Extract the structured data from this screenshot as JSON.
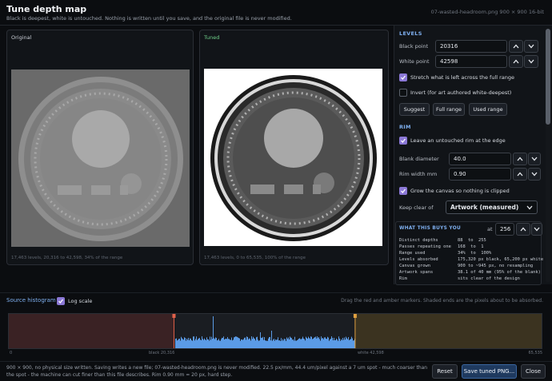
{
  "window": {
    "title": "Tune depth map",
    "subtitle": "Black is deepest, white is untouched. Nothing is written until you save, and the original file is never modified.",
    "file_info": "07-wasted-headroom.png   900 × 900   16-bit"
  },
  "preview": {
    "original": {
      "label": "Original",
      "footer": "17,463 levels, 20,316 to 42,598, 34% of the range"
    },
    "tuned": {
      "label": "Tuned",
      "footer": "17,463 levels, 0 to 65,535, 100% of the range"
    }
  },
  "levels": {
    "heading": "LEVELS",
    "black_point_label": "Black point",
    "black_point_value": "20316",
    "white_point_label": "White point",
    "white_point_value": "42598",
    "stretch_label": "Stretch what is left across the full range",
    "stretch_checked": true,
    "invert_label": "Invert (for art authored white-deepest)",
    "invert_checked": false,
    "buttons": [
      "Suggest",
      "Full range",
      "Used range"
    ]
  },
  "rim": {
    "heading": "RIM",
    "leave_rim_label": "Leave an untouched rim at the edge",
    "leave_rim_checked": true,
    "blank_diameter_label": "Blank diameter",
    "blank_diameter_value": "40.0",
    "rim_width_label": "Rim width mm",
    "rim_width_value": "0.90",
    "grow_label": "Grow the canvas so nothing is clipped",
    "grow_checked": true,
    "keep_clear_label": "Keep clear of",
    "keep_clear_value": "Artwork (measured)"
  },
  "buys": {
    "heading": "WHAT THIS BUYS YOU",
    "at_label": "at",
    "at_value": "256",
    "rows": [
      {
        "k": "Distinct depths",
        "v": "88  to  255"
      },
      {
        "k": "Passes repeating one",
        "v": "168  to  1"
      },
      {
        "k": "Range used",
        "v": "34%  to  100%"
      },
      {
        "k": "Levels absorbed",
        "v": "175,320 px black, 65,200 px white"
      },
      {
        "k": "Canvas grown",
        "v": "900 to ~945 px, no resampling"
      },
      {
        "k": "Artwork spans",
        "v": "38.1 of 40 mm (95% of the blank)"
      },
      {
        "k": "Rim",
        "v": "sits clear of the design"
      }
    ]
  },
  "histogram": {
    "title": "Source histogram",
    "log_label": "Log scale",
    "log_checked": true,
    "hint": "Drag the red and amber markers. Shaded ends are the pixels about to be absorbed.",
    "axis_min": "0",
    "axis_max": "65,535",
    "black_marker_label": "black 20,316",
    "white_marker_label": "white 42,598",
    "black_point": 20316,
    "white_point": 42598,
    "range_max": 65535
  },
  "footer": {
    "status": "900 × 900, no physical size written. Saving writes a new file; 07-wasted-headroom.png is never modified.   22.5 px/mm, 44.4 um/pixel against a 7 um spot - much coarser than the spot - the machine can cut finer than this file describes.  Rim 0.90 mm = 20 px, hard step.",
    "reset_label": "Reset",
    "save_label": "Save tuned PNG...",
    "close_label": "Close"
  },
  "colors": {
    "accent_blue": "#7fb0f0",
    "checkbox_purple": "#8b78d6",
    "black_marker": "#e0614a",
    "white_marker": "#e0a040",
    "histogram_bars": "#5b9be6"
  }
}
